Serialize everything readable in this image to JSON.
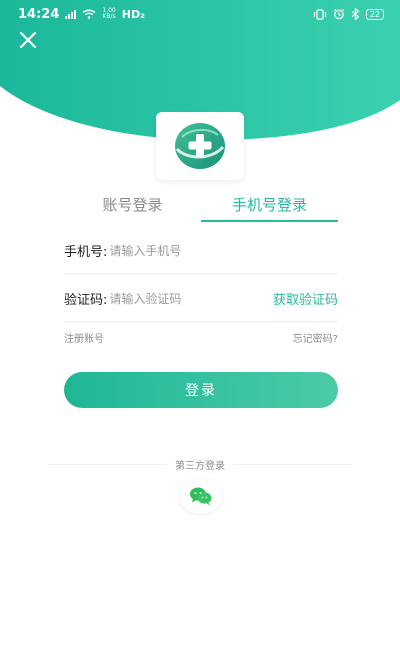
{
  "status_bar": {
    "time": "14:24",
    "network": "HD₂",
    "net_speed_value": "1.00",
    "net_speed_unit": "KB/s",
    "battery": "22"
  },
  "tabs": [
    {
      "label": "账号登录",
      "active": false
    },
    {
      "label": "手机号登录",
      "active": true
    }
  ],
  "form": {
    "phone_label": "手机号:",
    "phone_placeholder": "请输入手机号",
    "code_label": "验证码:",
    "code_placeholder": "请输入验证码",
    "get_code_label": "获取验证码"
  },
  "links": {
    "register": "注册账号",
    "forgot_password": "忘记密码?"
  },
  "login_button": "登录",
  "third_party_label": "第三方登录",
  "icons": {
    "close": "close-icon",
    "logo": "app-logo",
    "wechat": "wechat-icon"
  },
  "colors": {
    "accent": "#27b8a0",
    "header_gradient_start": "#1ab89a",
    "header_gradient_end": "#3ad1b0"
  }
}
